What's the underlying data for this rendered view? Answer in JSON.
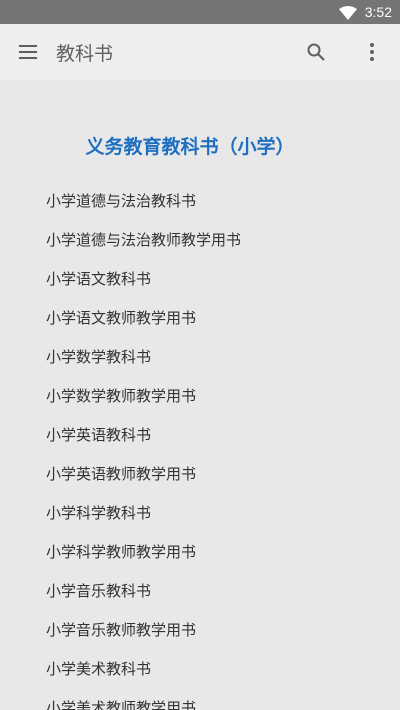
{
  "status_bar": {
    "time": "3:52",
    "wifi_icon": "wifi-icon"
  },
  "app_bar": {
    "title": "教科书",
    "menu_icon": "menu-icon",
    "search_icon": "search-icon",
    "more_icon": "more-vert-icon"
  },
  "section": {
    "title": "义务教育教科书（小学）"
  },
  "books": [
    "小学道德与法治教科书",
    "小学道德与法治教师教学用书",
    "小学语文教科书",
    "小学语文教师教学用书",
    "小学数学教科书",
    "小学数学教师教学用书",
    "小学英语教科书",
    "小学英语教师教学用书",
    "小学科学教科书",
    "小学科学教师教学用书",
    "小学音乐教科书",
    "小学音乐教师教学用书",
    "小学美术教科书",
    "小学美术教师教学用书"
  ],
  "colors": {
    "status_bar": "#757575",
    "background": "#e8e8e8",
    "section_title": "#1e6fc0"
  }
}
